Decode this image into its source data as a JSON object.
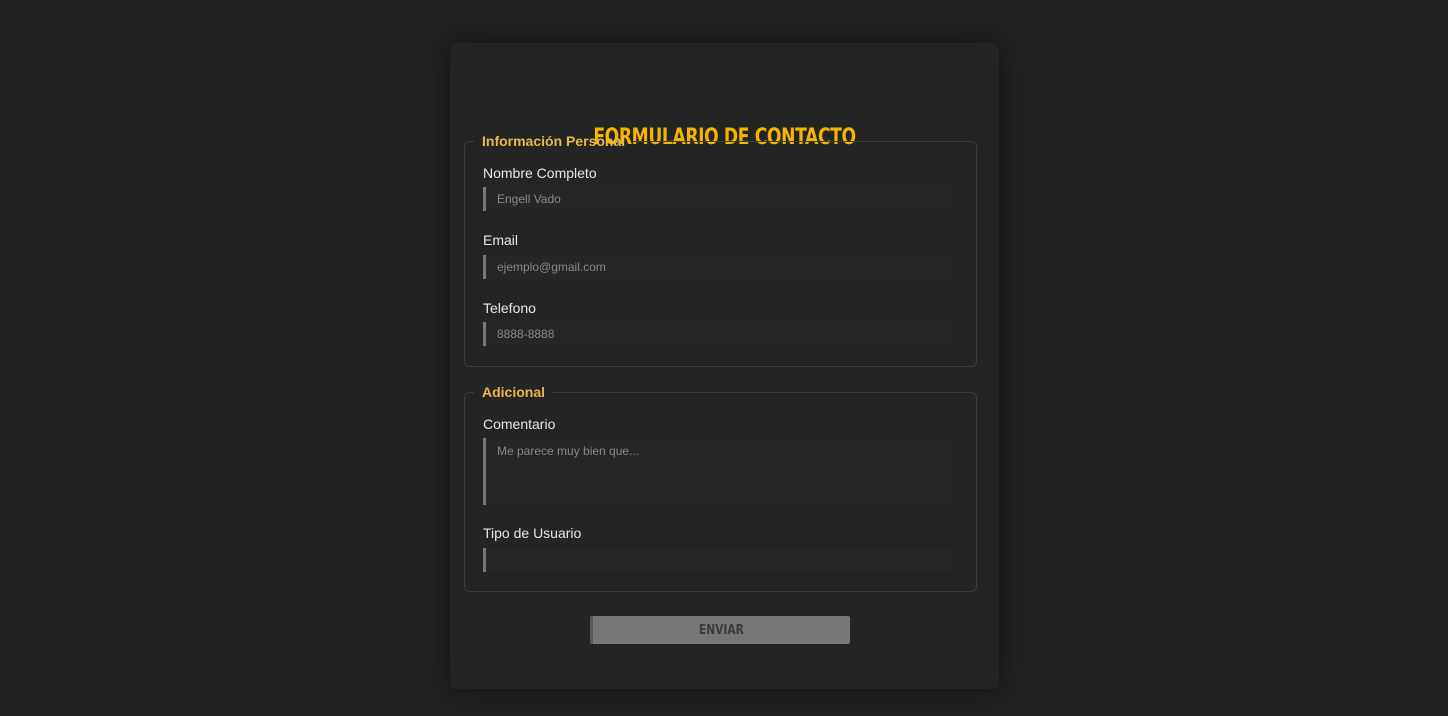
{
  "form": {
    "title": "Formulario de Contacto",
    "personal": {
      "legend": "Información Personal",
      "name_label": "Nombre Completo",
      "name_placeholder": "Engell Vado",
      "email_label": "Email",
      "email_placeholder": "ejemplo@gmail.com",
      "phone_label": "Telefono",
      "phone_placeholder": "8888-8888"
    },
    "additional": {
      "legend": "Adicional",
      "comment_label": "Comentario",
      "comment_placeholder": "Me parece muy bien que...",
      "user_type_label": "Tipo de Usuario",
      "user_type_value": ""
    },
    "submit_label": "Enviar"
  },
  "colors": {
    "background": "#222222",
    "card": "#242424",
    "accent_title": "#f5b400",
    "legend": "#e6b94a",
    "button": "#777777"
  }
}
